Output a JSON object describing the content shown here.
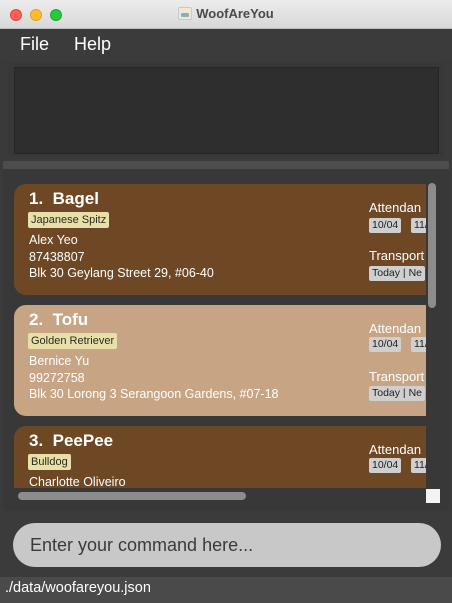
{
  "window": {
    "title": "WoofAreYou",
    "app_icon": "dog-app-icon"
  },
  "menu": {
    "file_label": "File",
    "help_label": "Help"
  },
  "result_display": {
    "text": ""
  },
  "pets": [
    {
      "index": "1.",
      "name": "Bagel",
      "breed": "Japanese Spitz",
      "owner": "Alex Yeo",
      "phone": "87438807",
      "address": "Blk 30 Geylang Street 29, #06-40",
      "attendance_label": "Attendan",
      "attendance_tags": [
        "10/04",
        "11/"
      ],
      "transport_label": "Transport",
      "transport_tags": [
        "Today | Ne"
      ],
      "card_color": "#6e4824"
    },
    {
      "index": "2.",
      "name": "Tofu",
      "breed": "Golden Retriever",
      "owner": "Bernice Yu",
      "phone": "99272758",
      "address": "Blk 30 Lorong 3 Serangoon Gardens, #07-18",
      "attendance_label": "Attendan",
      "attendance_tags": [
        "10/04",
        "11/"
      ],
      "transport_label": "Transport",
      "transport_tags": [
        "Today | Ne"
      ],
      "card_color": "#c6a484"
    },
    {
      "index": "3.",
      "name": "PeePee",
      "breed": "Bulldog",
      "owner": "Charlotte Oliveiro",
      "attendance_label": "Attendan",
      "attendance_tags": [
        "10/04",
        "11/"
      ],
      "card_color": "#6e4824"
    }
  ],
  "command": {
    "placeholder": "Enter your command here...",
    "value": ""
  },
  "status": {
    "path": "./data/woofareyou.json"
  },
  "colors": {
    "card_dark": "#6e4824",
    "card_light": "#c6a484",
    "breed_tag": "#e8e0a8",
    "background": "#3a3a3a"
  }
}
